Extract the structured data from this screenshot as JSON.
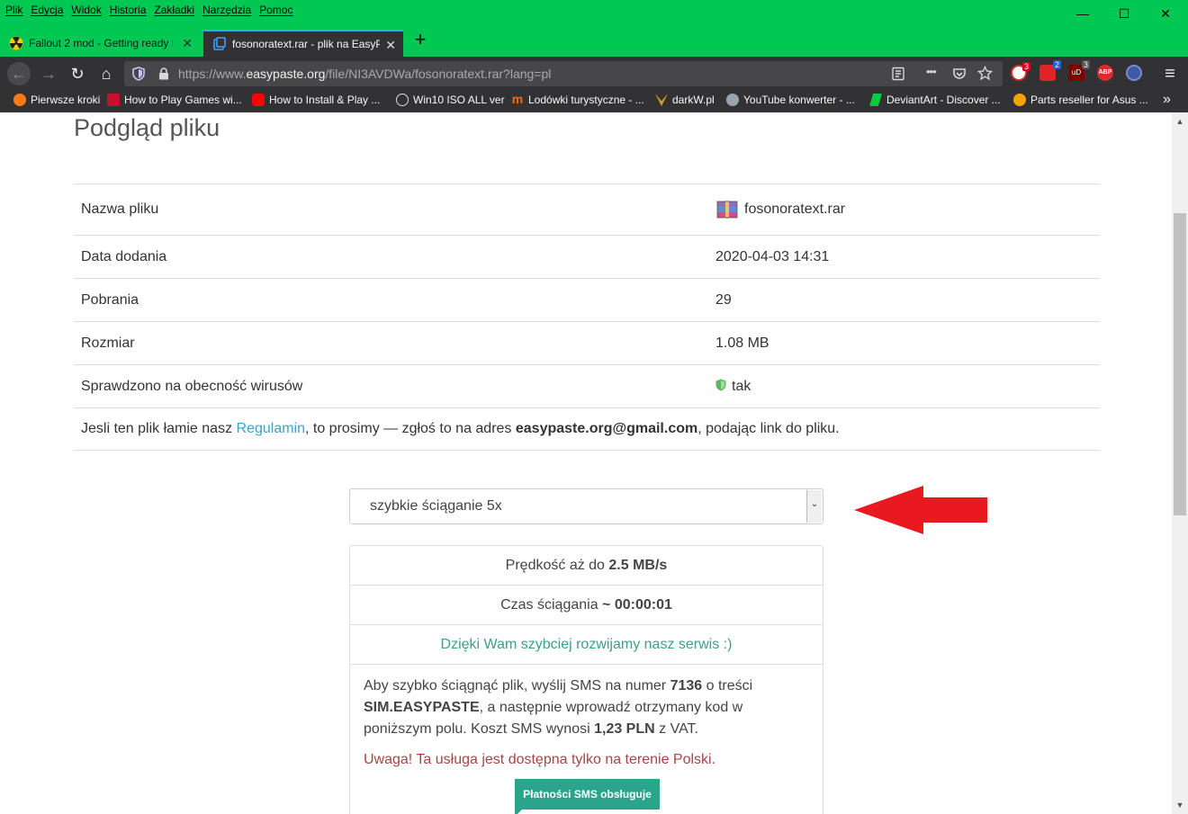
{
  "browser": {
    "menu": [
      "Plik",
      "Edycja",
      "Widok",
      "Historia",
      "Zakładki",
      "Narzędzia",
      "Pomoc"
    ],
    "window_controls": {
      "minimize": "—",
      "maximize": "☐",
      "close": "✕"
    },
    "tabs": [
      {
        "label": "Fallout 2 mod - Getting ready f",
        "close": "✕"
      },
      {
        "label": "fosonoratext.rar - plik na EasyP",
        "close": "✕"
      }
    ],
    "new_tab": "+",
    "url": {
      "prefix": "https://www.",
      "host": "easypaste.org",
      "path": "/file/NI3AVDWa/fosonoratext.rar?lang=pl"
    },
    "nav": {
      "back": "←",
      "forward": "→",
      "reload": "↻",
      "home": "⌂",
      "more": "•••",
      "menu": "≡",
      "overflow": "»"
    },
    "extension_badges": [
      "3",
      "2",
      "3"
    ],
    "abp_label": "ABP",
    "ublock_label": "uD",
    "bookmarks": [
      "Pierwsze kroki",
      "How to Play Games wi...",
      "How to Install & Play ...",
      "Win10 ISO ALL ver",
      "Lodówki turystyczne - ...",
      "darkW.pl",
      "YouTube konwerter - ...",
      "DeviantArt - Discover ...",
      "Parts reseller for Asus ..."
    ],
    "scroll": {
      "up": "▲",
      "down": "▼"
    }
  },
  "page": {
    "title": "Podgląd pliku",
    "rows": [
      {
        "label": "Nazwa pliku",
        "value": "fosonoratext.rar"
      },
      {
        "label": "Data dodania",
        "value": "2020-04-03 14:31"
      },
      {
        "label": "Pobrania",
        "value": "29"
      },
      {
        "label": "Rozmiar",
        "value": "1.08 MB"
      },
      {
        "label": "Sprawdzono na obecność wirusów",
        "value": "tak"
      }
    ],
    "report": {
      "before": "Jesli ten plik łamie nasz ",
      "link": "Regulamin",
      "middle": ", to prosimy — zgłoś to na adres ",
      "email": "easypaste.org@gmail.com",
      "after": ", podając link do pliku."
    },
    "select": {
      "value": "szybkie ściąganie 5x",
      "arrow": "⌄"
    },
    "panel": {
      "speed_prefix": "Prędkość aż do ",
      "speed_value": "2.5 MB/s",
      "time_prefix": "Czas ściągania ",
      "time_value": "~ 00:00:01",
      "thanks": "Dzięki Wam szybciej rozwijamy nasz serwis :)",
      "sms_1": "Aby szybko ściągnąć plik, wyślij SMS na numer ",
      "sms_number": "7136",
      "sms_2": " o treści ",
      "sms_code": "SIM.EASYPASTE",
      "sms_3": ", a następnie wprowadź otrzymany kod w poniższym polu. Koszt SMS wynosi ",
      "sms_price": "1,23 PLN",
      "sms_4": " z VAT.",
      "warning": "Uwaga! Ta usługa jest dostępna tylko na terenie Polski.",
      "sms_button": "Płatności SMS obsługuje"
    }
  },
  "colors": {
    "titlebar": "#00c853",
    "toolbar": "#323234",
    "link": "#3ea0c9",
    "green_text": "#3aa08a",
    "warning": "#a94442",
    "arrow": "#e8191f"
  }
}
